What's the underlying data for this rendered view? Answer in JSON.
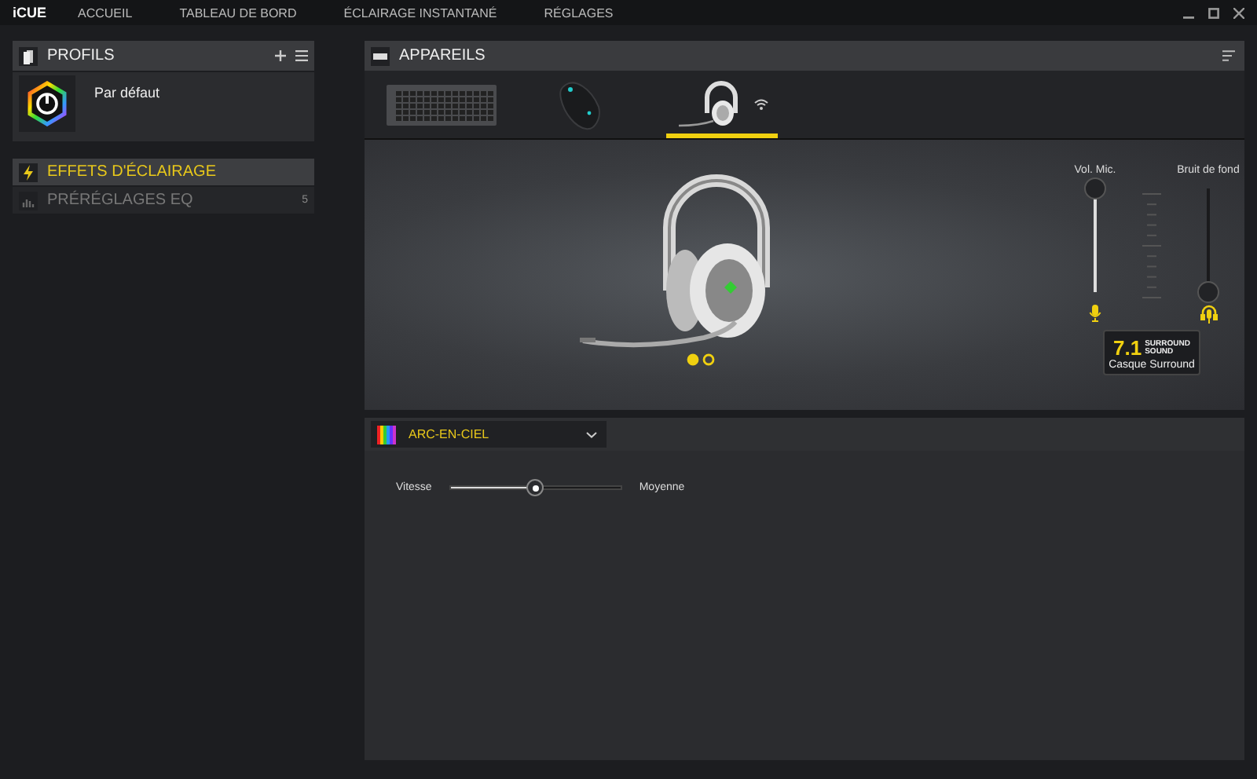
{
  "app": {
    "logo": "iCUE",
    "nav": [
      {
        "label": "ACCUEIL",
        "selected": false
      },
      {
        "label": "TABLEAU DE BORD",
        "selected": false
      },
      {
        "label": "ÉCLAIRAGE INSTANTANÉ",
        "selected": false
      },
      {
        "label": "RÉGLAGES",
        "selected": false
      }
    ]
  },
  "profiles": {
    "title": "PROFILS",
    "items": [
      {
        "name": "Par défaut"
      }
    ]
  },
  "sidebar": {
    "items": [
      {
        "kind": "lighting",
        "label": "EFFETS D'ÉCLAIRAGE",
        "selected": true
      },
      {
        "kind": "eq",
        "label": "PRÉRÉGLAGES EQ",
        "selected": false,
        "count": "5"
      }
    ]
  },
  "devices": {
    "title": "APPAREILS",
    "items": [
      {
        "kind": "keyboard",
        "selected": false
      },
      {
        "kind": "mouse",
        "selected": false
      },
      {
        "kind": "headset",
        "selected": true
      }
    ]
  },
  "headset": {
    "zones": [
      {
        "selected": true
      },
      {
        "selected": false
      }
    ]
  },
  "audio": {
    "sliders": [
      {
        "kind": "mic",
        "label": "Vol. Mic.",
        "level": 1
      },
      {
        "kind": "noise",
        "label": "Bruit de fond",
        "level": 0
      }
    ],
    "surround": {
      "number": "7.1",
      "line1": "SURROUND",
      "line2": "SOUND",
      "label": "Casque Surround"
    }
  },
  "lighting": {
    "effect": "ARC-EN-CIEL",
    "speed": {
      "label": "Vitesse",
      "level": 0.5,
      "reading": "Moyenne"
    }
  }
}
